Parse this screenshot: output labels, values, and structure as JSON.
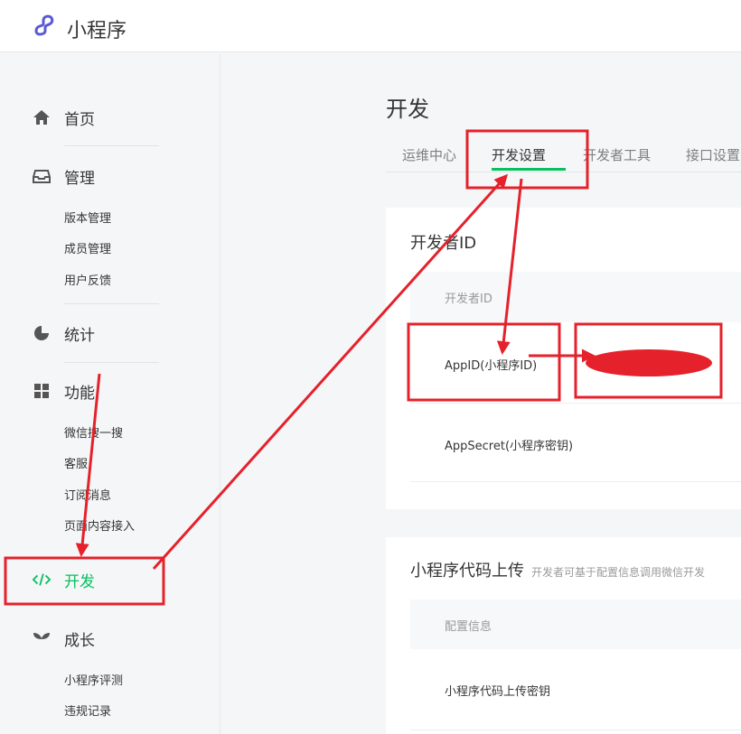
{
  "app": {
    "title": "小程序"
  },
  "sidebar": {
    "items": [
      {
        "label": "首页",
        "icon": "home-icon"
      },
      {
        "label": "管理",
        "icon": "inbox-icon",
        "children": [
          "版本管理",
          "成员管理",
          "用户反馈"
        ]
      },
      {
        "label": "统计",
        "icon": "pie-chart-icon"
      },
      {
        "label": "功能",
        "icon": "grid-icon",
        "children": [
          "微信搜一搜",
          "客服",
          "订阅消息",
          "页面内容接入"
        ]
      },
      {
        "label": "开发",
        "icon": "code-icon",
        "active": true
      },
      {
        "label": "成长",
        "icon": "sprout-icon",
        "children": [
          "小程序评测",
          "违规记录"
        ]
      }
    ]
  },
  "main": {
    "title": "开发",
    "tabs": [
      {
        "label": "运维中心"
      },
      {
        "label": "开发设置",
        "active": true
      },
      {
        "label": "开发者工具"
      },
      {
        "label": "接口设置"
      }
    ],
    "developer_id_card": {
      "title": "开发者ID",
      "table_header": "开发者ID",
      "rows": [
        {
          "label": "AppID(小程序ID)"
        },
        {
          "label": "AppSecret(小程序密钥)"
        }
      ]
    },
    "upload_card": {
      "title": "小程序代码上传",
      "subtitle": "开发者可基于配置信息调用微信开发",
      "table_header": "配置信息",
      "rows": [
        {
          "label": "小程序代码上传密钥"
        }
      ]
    }
  },
  "colors": {
    "accent_green": "#07c160",
    "annotation_red": "#e5212b",
    "logo_purple": "#5b5ad6"
  }
}
